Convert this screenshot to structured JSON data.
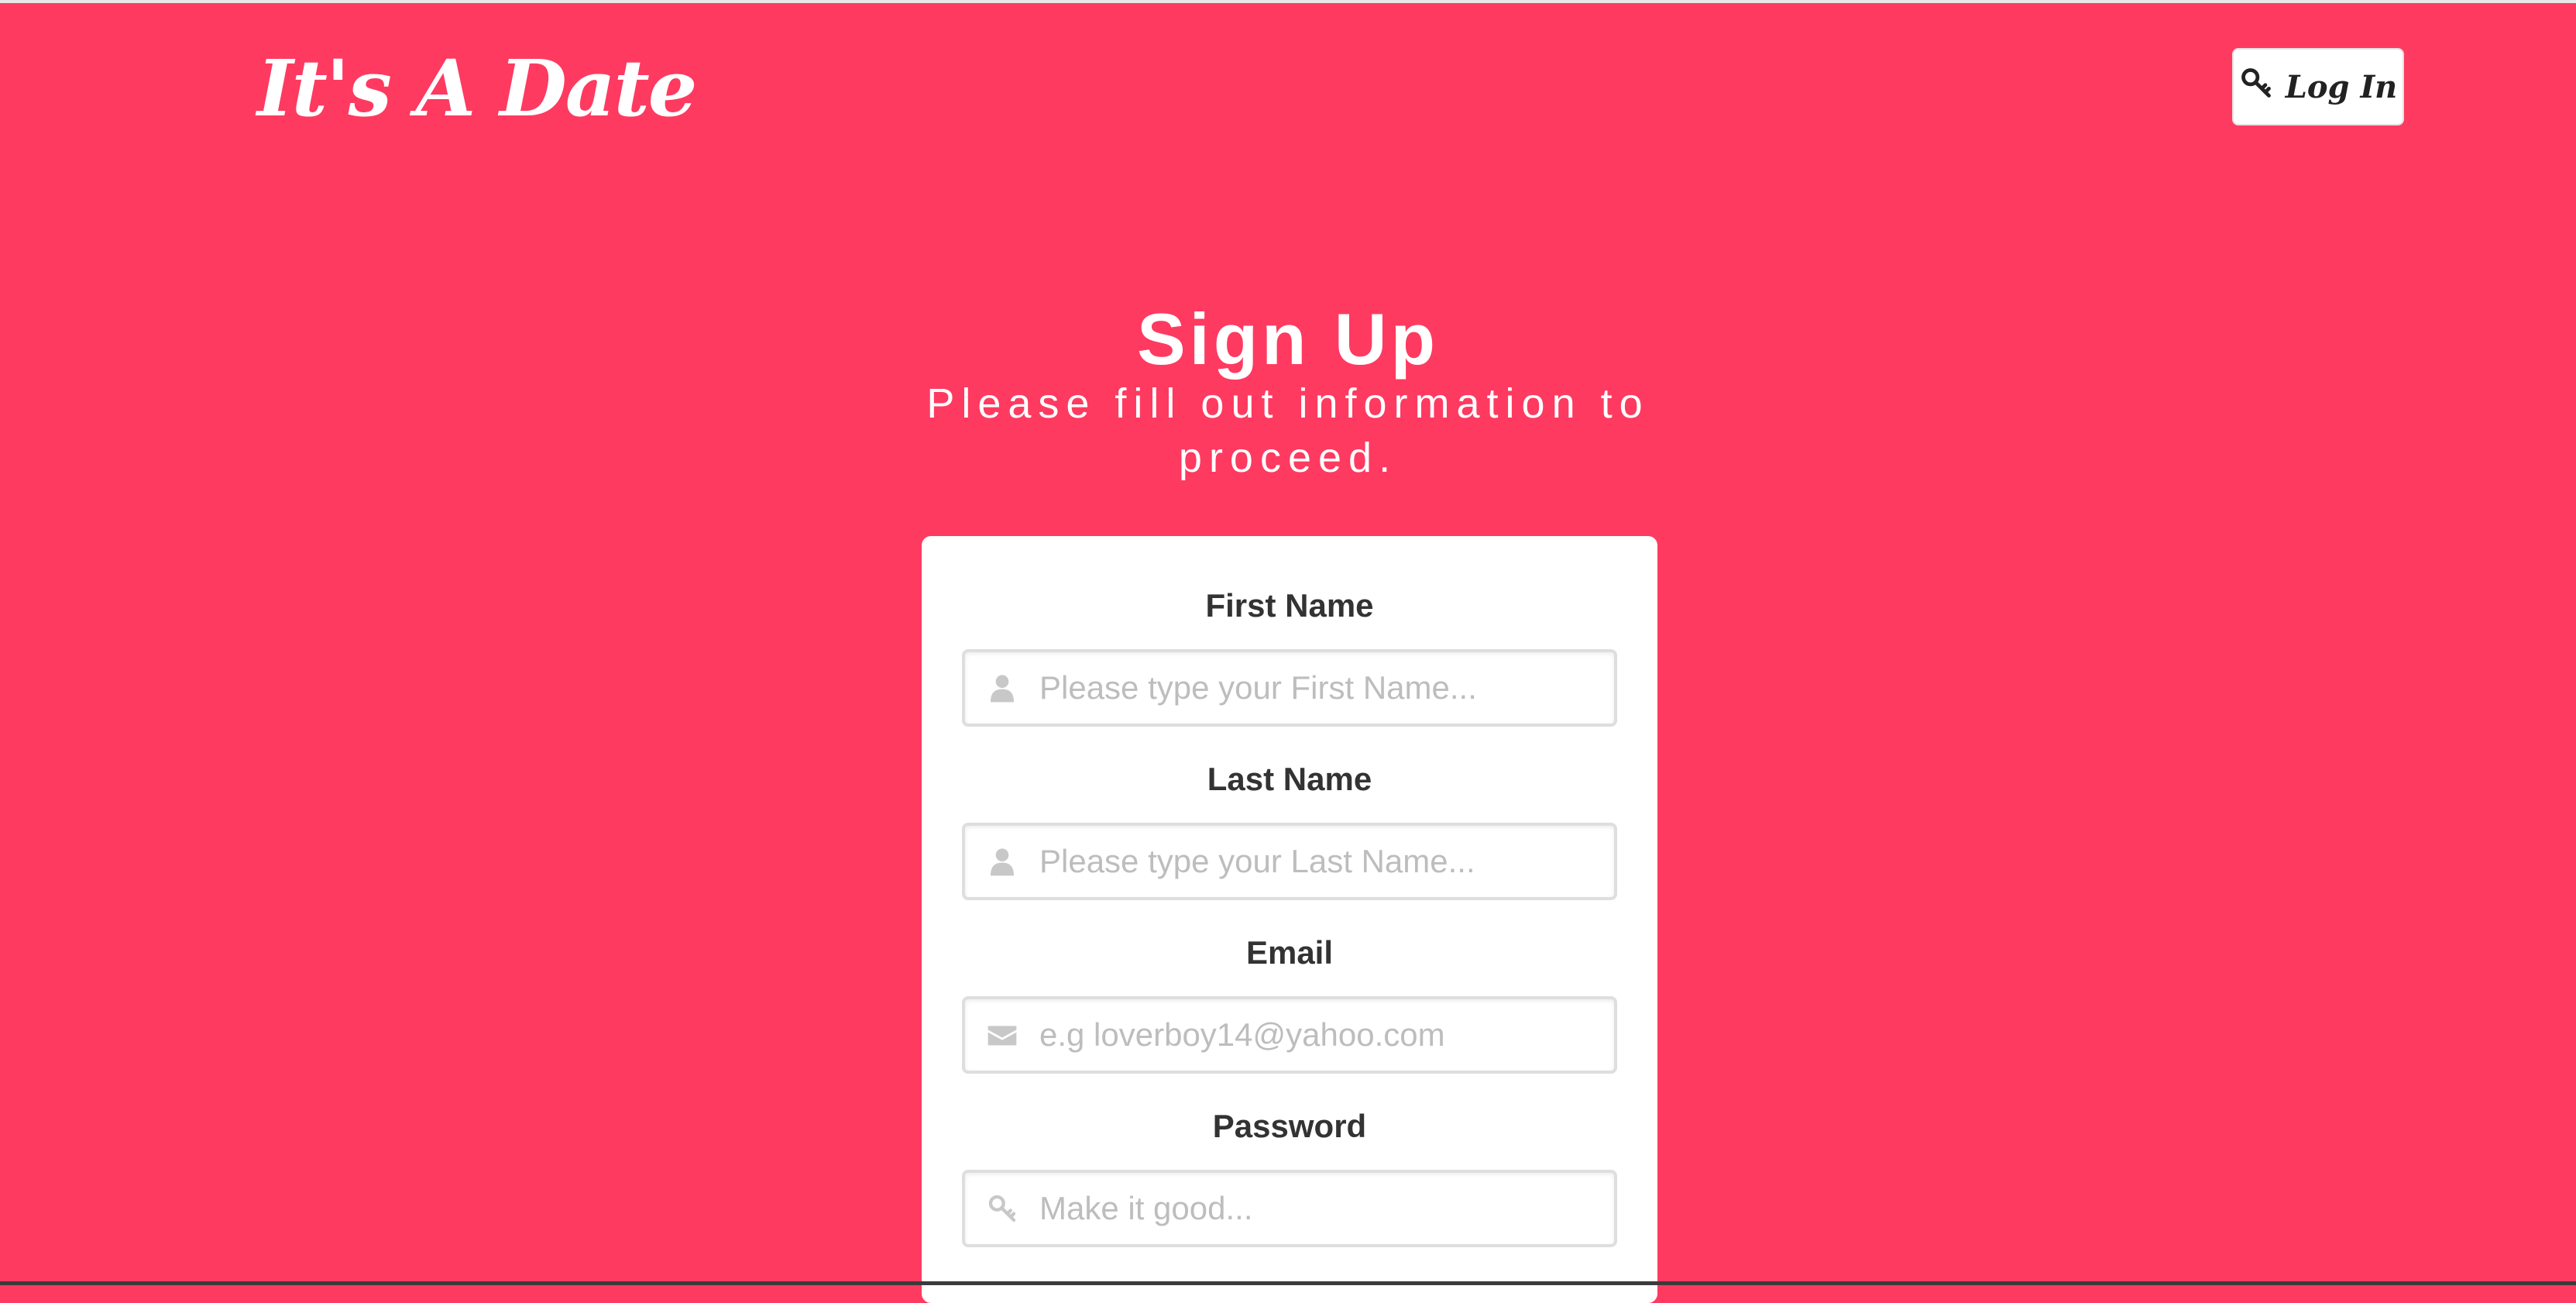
{
  "header": {
    "brand": "It's A Date",
    "login_label": "Log In"
  },
  "hero": {
    "title": "Sign Up",
    "subtitle": "Please fill out information to proceed."
  },
  "form": {
    "first_name": {
      "label": "First Name",
      "placeholder": "Please type your First Name...",
      "icon": "user-icon"
    },
    "last_name": {
      "label": "Last Name",
      "placeholder": "Please type your Last Name...",
      "icon": "user-icon"
    },
    "email": {
      "label": "Email",
      "placeholder": "e.g loverboy14@yahoo.com",
      "icon": "envelope-icon"
    },
    "password": {
      "label": "Password",
      "placeholder": "Make it good...",
      "icon": "key-icon"
    }
  },
  "colors": {
    "background": "#fe3a60",
    "card": "#ffffff",
    "icon": "#c8c8c8"
  }
}
